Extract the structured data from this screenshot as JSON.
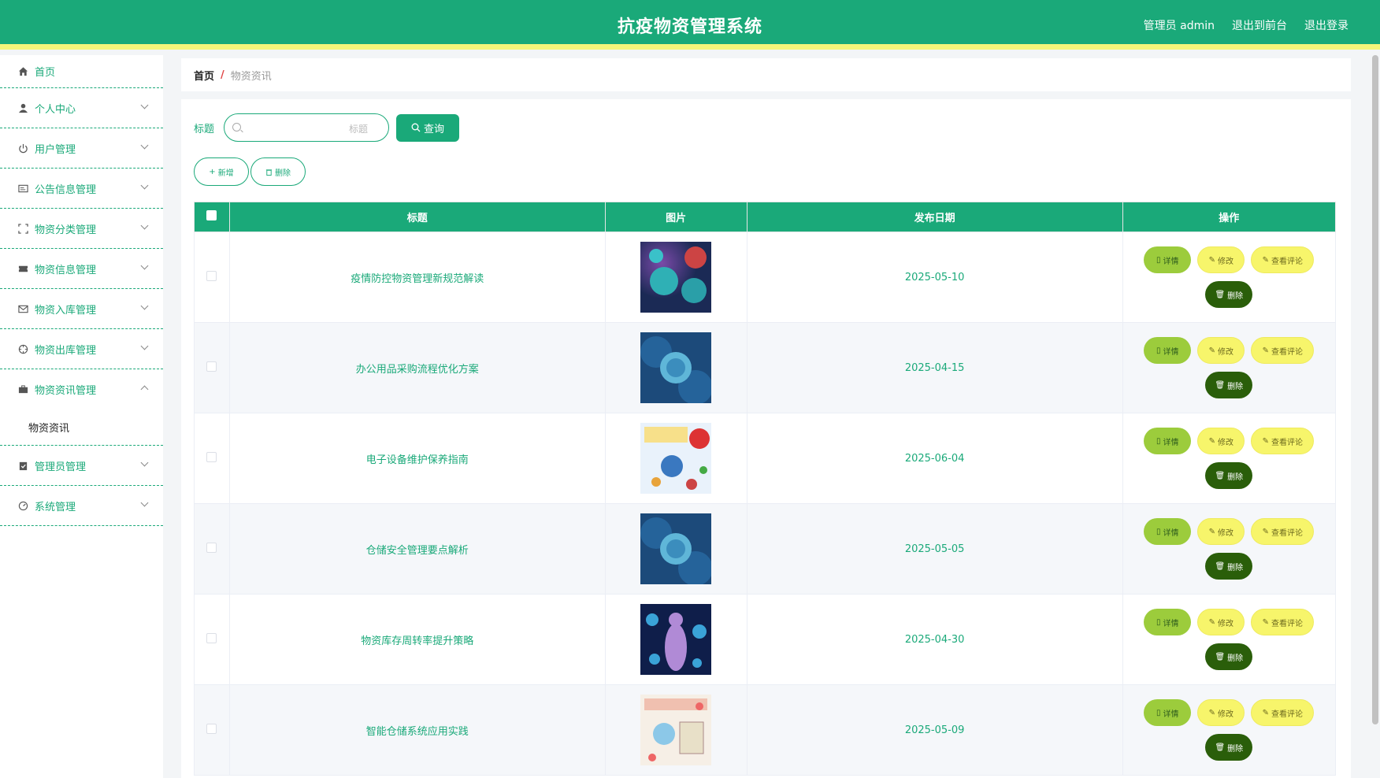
{
  "header": {
    "title": "抗疫物资管理系统",
    "user": "管理员 admin",
    "to_front": "退出到前台",
    "logout": "退出登录"
  },
  "sidebar": {
    "items": [
      {
        "label": "首页",
        "icon": "home-icon"
      },
      {
        "label": "个人中心",
        "icon": "user-icon"
      },
      {
        "label": "用户管理",
        "icon": "power-icon"
      },
      {
        "label": "公告信息管理",
        "icon": "card-icon"
      },
      {
        "label": "物资分类管理",
        "icon": "frame-icon"
      },
      {
        "label": "物资信息管理",
        "icon": "ticket-icon"
      },
      {
        "label": "物资入库管理",
        "icon": "mail-icon"
      },
      {
        "label": "物资出库管理",
        "icon": "crosshair-icon"
      },
      {
        "label": "物资资讯管理",
        "icon": "briefcase-icon"
      },
      {
        "label": "管理员管理",
        "icon": "clipboard-icon"
      },
      {
        "label": "系统管理",
        "icon": "gauge-icon"
      }
    ],
    "submenu_label": "物资资讯"
  },
  "breadcrumb": {
    "home": "首页",
    "separator": "/",
    "current": "物资资讯"
  },
  "search": {
    "label": "标题",
    "placeholder": "标题",
    "button": "查询"
  },
  "actions": {
    "add": "新增",
    "delete": "删除"
  },
  "table": {
    "columns": [
      "标题",
      "图片",
      "发布日期",
      "操作"
    ],
    "rows": [
      {
        "title": "疫情防控物资管理新规范解读",
        "date": "2025-05-10",
        "image": "virus-red"
      },
      {
        "title": "办公用品采购流程优化方案",
        "date": "2025-04-15",
        "image": "virus-blue"
      },
      {
        "title": "电子设备维护保养指南",
        "date": "2025-06-04",
        "image": "poster"
      },
      {
        "title": "仓储安全管理要点解析",
        "date": "2025-05-05",
        "image": "virus-blue"
      },
      {
        "title": "物资库存周转率提升策略",
        "date": "2025-04-30",
        "image": "body-virus"
      },
      {
        "title": "智能仓储系统应用实践",
        "date": "2025-05-09",
        "image": "drawing"
      }
    ],
    "ops": {
      "detail": "详情",
      "edit": "修改",
      "comment": "查看评论",
      "delete": "删除"
    }
  },
  "colors": {
    "primary": "#1aa979",
    "accent_strip": "#f5f57a",
    "detail_btn": "#9ccc3c",
    "edit_btn": "#f7f56b",
    "delete_btn": "#2a5e0a"
  }
}
